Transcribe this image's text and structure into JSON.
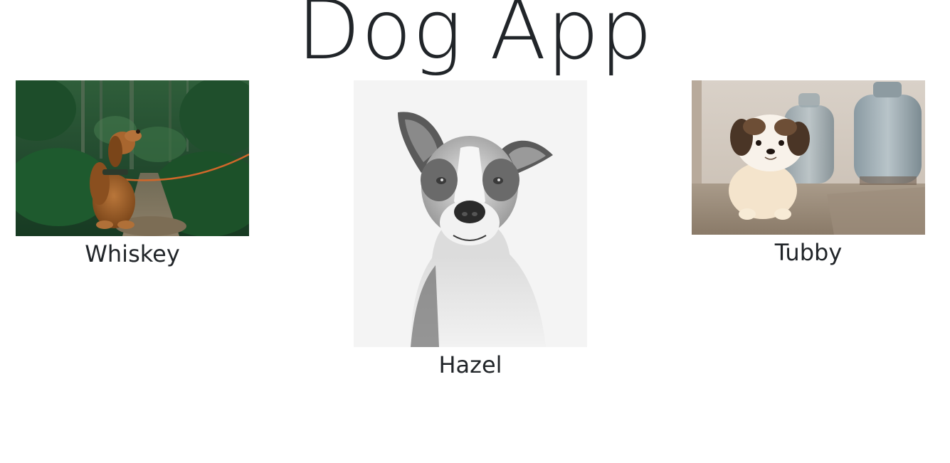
{
  "app": {
    "title": "Dog App"
  },
  "dogs": [
    {
      "name": "Whiskey",
      "photo_icon": "spaniel-in-forest-photo"
    },
    {
      "name": "Hazel",
      "photo_icon": "pit-bull-portrait-photo"
    },
    {
      "name": "Tubby",
      "photo_icon": "shih-tzu-puppy-photo"
    }
  ],
  "colors": {
    "text": "#212529",
    "background": "#ffffff"
  }
}
